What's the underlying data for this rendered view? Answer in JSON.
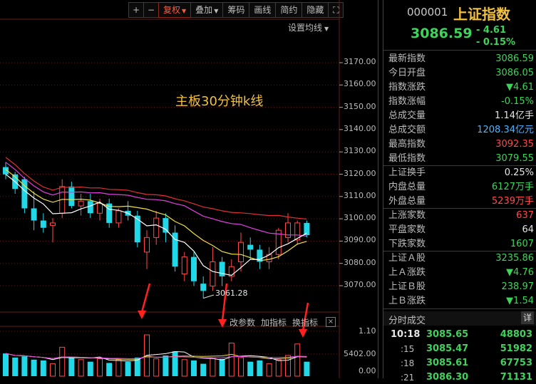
{
  "toolbar": {
    "plus": "+",
    "minus": "−",
    "fuquan": "复权",
    "diejia": "叠加",
    "chouma": "筹码",
    "huaxian": "画线",
    "jianyue": "简约",
    "yincang": "隐藏",
    "setting": "设置均线"
  },
  "chart": {
    "title": "主板30分钟k线",
    "y_ticks": [
      "3170.00",
      "3160.00",
      "3150.00",
      "3140.00",
      "3130.00",
      "3120.00",
      "3110.00",
      "3100.00",
      "3090.00",
      "3080.00",
      "3070.00"
    ],
    "min_label": "3061.28",
    "vol_buttons": [
      "改参数",
      "加指标",
      "换指标"
    ],
    "vol_close": "×",
    "vol_ticks": [
      "1.10",
      "5402.00",
      "0.00"
    ]
  },
  "panel": {
    "code": "000001",
    "name": "上证指数",
    "price": "3086.59",
    "change": "- 4.61",
    "change_pct": "- 0.15%",
    "rows": [
      {
        "label": "最新指数",
        "value": "3086.59",
        "color": "#3ed35a"
      },
      {
        "label": "今日开盘",
        "value": "3086.05",
        "color": "#3ed35a"
      },
      {
        "label": "指数涨跌",
        "value": "▼4.61",
        "color": "#3ed35a"
      },
      {
        "label": "指数涨幅",
        "value": "-0.15%",
        "color": "#3ed35a"
      },
      {
        "label": "总成交量",
        "value": "1.14亿手",
        "color": "#e6e6e6"
      },
      {
        "label": "总成交额",
        "value": "1208.34亿元",
        "color": "#4fb4ff"
      },
      {
        "label": "最高指数",
        "value": "3092.35",
        "color": "#ff4a4a"
      },
      {
        "label": "最低指数",
        "value": "3079.55",
        "color": "#3ed35a"
      },
      {
        "label": "上证换手",
        "value": "0.25%",
        "color": "#e6e6e6"
      },
      {
        "label": "内盘总量",
        "value": "6127万手",
        "color": "#3ed35a"
      },
      {
        "label": "外盘总量",
        "value": "5239万手",
        "color": "#ff4a4a"
      },
      {
        "label": "上涨家数",
        "value": "637",
        "color": "#ff4a4a"
      },
      {
        "label": "平盘家数",
        "value": "64",
        "color": "#e6e6e6"
      },
      {
        "label": "下跌家数",
        "value": "1607",
        "color": "#3ed35a"
      },
      {
        "label": "上证Ａ股",
        "value": "3235.86",
        "color": "#3ed35a"
      },
      {
        "label": "上Ａ涨跌",
        "value": "▼4.76",
        "color": "#3ed35a"
      },
      {
        "label": "上证Ｂ股",
        "value": "238.97",
        "color": "#3ed35a"
      },
      {
        "label": "上Ｂ涨跌",
        "value": "▼1.54",
        "color": "#3ed35a"
      }
    ],
    "ticks_title": "分时成交",
    "ticks_detail": "详",
    "ticks": [
      {
        "time": "10:18",
        "price": "3085.65",
        "vol": "48803"
      },
      {
        "time": ":15",
        "price": "3085.47",
        "vol": "51982"
      },
      {
        "time": ":18",
        "price": "3085.61",
        "vol": "67753"
      },
      {
        "time": ":21",
        "price": "3086.30",
        "vol": "71131"
      }
    ]
  },
  "colors": {
    "up": "#ff4a4a",
    "down": "#20d8e8",
    "ma5": "#ffffff",
    "ma10": "#f0e040",
    "ma20": "#e040e0",
    "ma30": "#e03030"
  },
  "chart_data": {
    "type": "candlestick",
    "ylim": [
      3060,
      3175
    ],
    "candles": [
      {
        "o": 3115,
        "h": 3117,
        "l": 3110,
        "c": 3112
      },
      {
        "o": 3112,
        "h": 3113,
        "l": 3104,
        "c": 3106
      },
      {
        "o": 3110,
        "h": 3111,
        "l": 3096,
        "c": 3098
      },
      {
        "o": 3098,
        "h": 3105,
        "l": 3089,
        "c": 3093
      },
      {
        "o": 3093,
        "h": 3096,
        "l": 3088,
        "c": 3090
      },
      {
        "o": 3091,
        "h": 3094,
        "l": 3084,
        "c": 3092
      },
      {
        "o": 3096,
        "h": 3110,
        "l": 3094,
        "c": 3107
      },
      {
        "o": 3107,
        "h": 3109,
        "l": 3098,
        "c": 3099
      },
      {
        "o": 3099,
        "h": 3104,
        "l": 3095,
        "c": 3101
      },
      {
        "o": 3101,
        "h": 3104,
        "l": 3094,
        "c": 3096
      },
      {
        "o": 3096,
        "h": 3102,
        "l": 3093,
        "c": 3100
      },
      {
        "o": 3100,
        "h": 3102,
        "l": 3090,
        "c": 3092
      },
      {
        "o": 3092,
        "h": 3098,
        "l": 3090,
        "c": 3097
      },
      {
        "o": 3097,
        "h": 3101,
        "l": 3093,
        "c": 3095
      },
      {
        "o": 3095,
        "h": 3097,
        "l": 3082,
        "c": 3084
      },
      {
        "o": 3080,
        "h": 3089,
        "l": 3073,
        "c": 3086
      },
      {
        "o": 3086,
        "h": 3097,
        "l": 3083,
        "c": 3094
      },
      {
        "o": 3094,
        "h": 3096,
        "l": 3084,
        "c": 3088
      },
      {
        "o": 3088,
        "h": 3091,
        "l": 3072,
        "c": 3074
      },
      {
        "o": 3071,
        "h": 3080,
        "l": 3068,
        "c": 3078
      },
      {
        "o": 3078,
        "h": 3080,
        "l": 3066,
        "c": 3068
      },
      {
        "o": 3067,
        "h": 3070,
        "l": 3061,
        "c": 3064
      },
      {
        "o": 3066,
        "h": 3082,
        "l": 3064,
        "c": 3076
      },
      {
        "o": 3076,
        "h": 3078,
        "l": 3066,
        "c": 3070
      },
      {
        "o": 3070,
        "h": 3077,
        "l": 3068,
        "c": 3074
      },
      {
        "o": 3076,
        "h": 3088,
        "l": 3072,
        "c": 3084
      },
      {
        "o": 3083,
        "h": 3086,
        "l": 3077,
        "c": 3081
      },
      {
        "o": 3081,
        "h": 3083,
        "l": 3073,
        "c": 3076
      },
      {
        "o": 3076,
        "h": 3082,
        "l": 3073,
        "c": 3079
      },
      {
        "o": 3079,
        "h": 3090,
        "l": 3077,
        "c": 3089
      },
      {
        "o": 3086,
        "h": 3096,
        "l": 3084,
        "c": 3092
      },
      {
        "o": 3085,
        "h": 3093,
        "l": 3083,
        "c": 3092
      },
      {
        "o": 3092,
        "h": 3093,
        "l": 3086,
        "c": 3087
      }
    ],
    "volume": [
      0.55,
      0.45,
      0.48,
      0.4,
      0.38,
      0.3,
      0.7,
      0.45,
      0.4,
      0.35,
      0.42,
      0.32,
      0.4,
      0.35,
      0.45,
      1.0,
      0.42,
      0.5,
      0.6,
      0.4,
      0.38,
      0.3,
      0.45,
      0.42,
      0.8,
      0.45,
      0.35,
      0.38,
      0.3,
      0.4,
      0.5,
      0.78,
      0.35
    ]
  }
}
